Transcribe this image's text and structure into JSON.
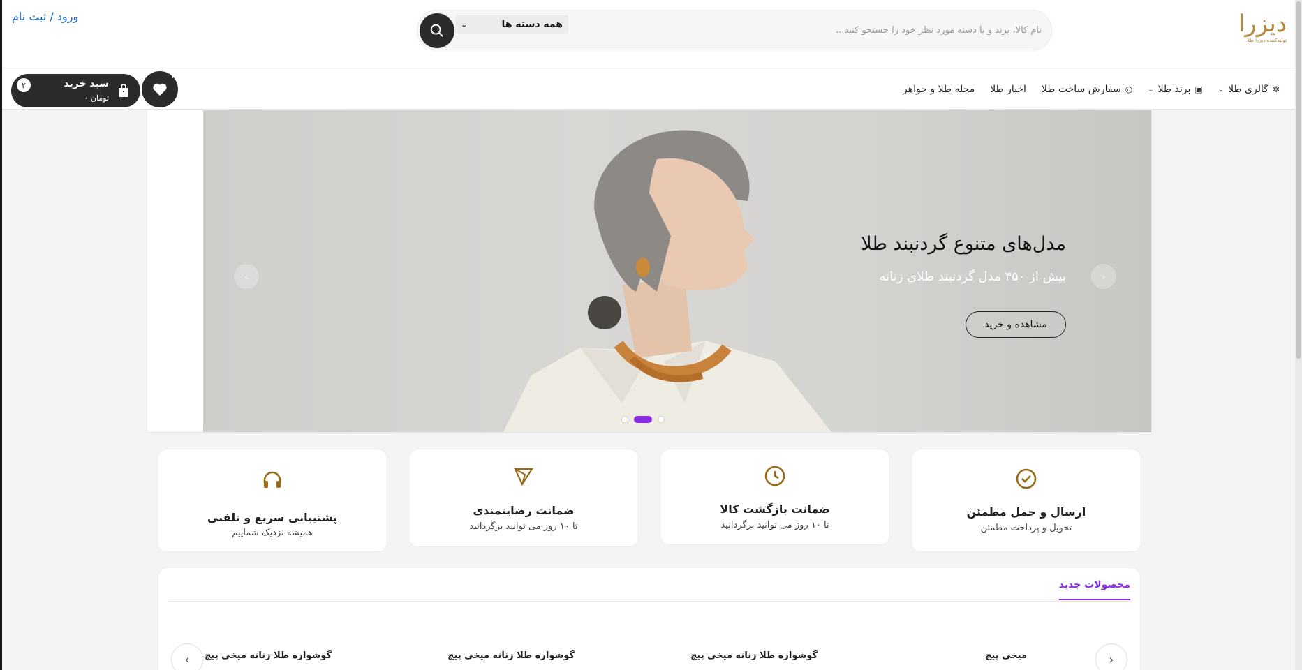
{
  "header": {
    "logo_text": "دیزرا",
    "logo_sub": "تولیدکننده دیزرا طلا",
    "search_category": "همه دسته ها",
    "search_placeholder": "نام کالا، برند و یا دسته مورد نظر خود را جستجو کنید...",
    "login_link": "ورود / ثبت نام"
  },
  "nav": {
    "items": [
      {
        "label": "گالری طلا",
        "icon": "sparkle-icon",
        "dropdown": true
      },
      {
        "label": "برند طلا",
        "icon": "store-icon",
        "dropdown": true
      },
      {
        "label": "سفارش ساخت طلا",
        "icon": "ring-icon",
        "dropdown": false
      },
      {
        "label": "اخبار طلا",
        "icon": "",
        "dropdown": false
      },
      {
        "label": "مجله طلا و جواهر",
        "icon": "",
        "dropdown": false
      }
    ],
    "cart_label": "سبد خرید",
    "cart_total": "تومان ۰",
    "cart_count": "۲",
    "wishlist_count": "۲"
  },
  "hero": {
    "title": "مدل‌های متنوع گردنبند طلا",
    "subtitle": "بیش از ۴۵۰ مدل گردنبند طلای زنانه",
    "button": "مشاهده و خرید",
    "active_slide": 2,
    "slide_count": 3
  },
  "features": [
    {
      "title": "ارسال و حمل مطمئن",
      "subtitle": "تحویل و پرداخت مطمئن",
      "icon": "check-circle-icon"
    },
    {
      "title": "ضمانت بازگشت کالا",
      "subtitle": "تا ۱۰ روز می توانید برگردانید",
      "icon": "clock-icon"
    },
    {
      "title": "ضمانت رضایتمندی",
      "subtitle": "تا ۱۰ روز می توانید برگردانید",
      "icon": "paper-plane-icon"
    },
    {
      "title": "پشتیبانی سریع و تلفنی",
      "subtitle": "همیشه نزدیک شماییم",
      "icon": "headset-icon"
    }
  ],
  "products": {
    "tab": "محصولات جدید",
    "items": [
      "میخی پیچ",
      "گوشواره طلا زنانه میخی پیچ",
      "گوشواره طلا زنانه میخی پیچ",
      "گوشواره طلا زنانه میخی پیچ"
    ]
  },
  "colors": {
    "accent": "#8a2be2",
    "gold": "#9a6a18",
    "dark": "#2b2b2b",
    "link": "#1766c4"
  }
}
